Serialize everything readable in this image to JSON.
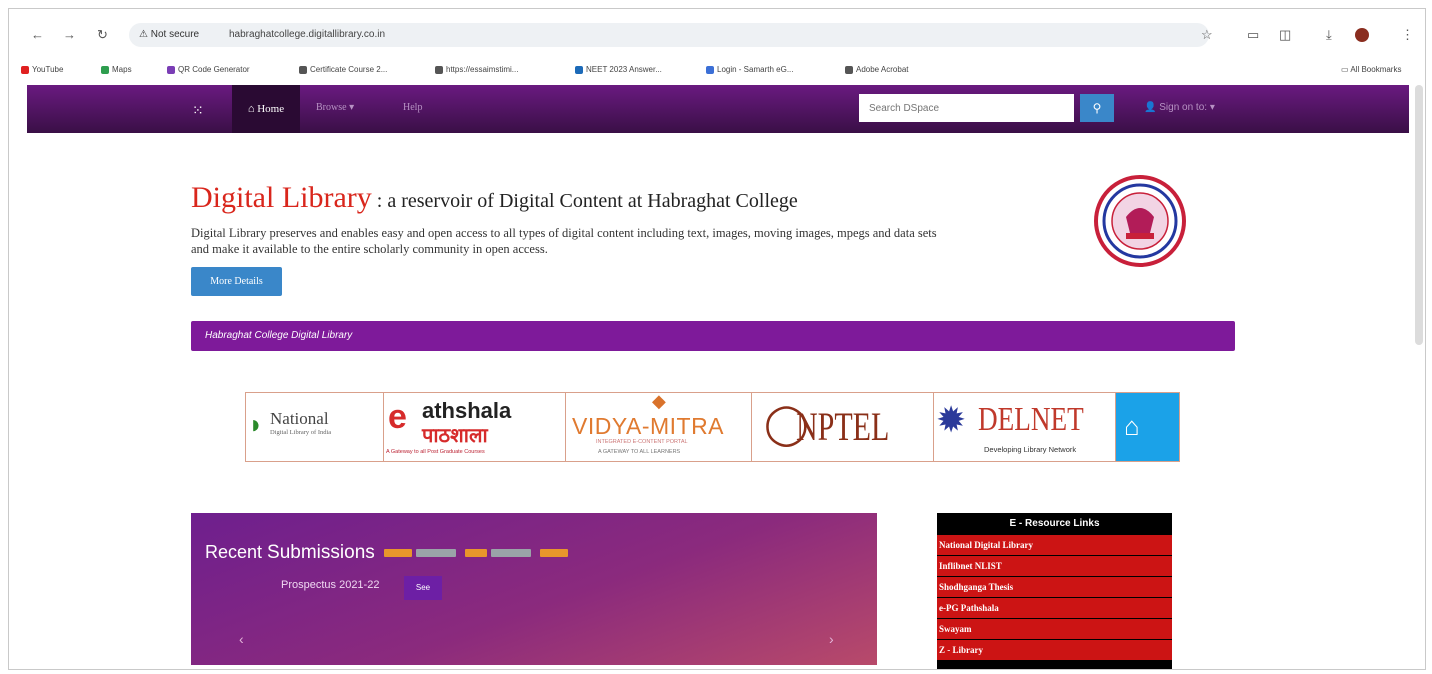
{
  "browser": {
    "security": "Not secure",
    "url": "habraghatcollege.digitallibrary.co.in",
    "bookmarks": [
      {
        "label": "YouTube",
        "color": "#e02020"
      },
      {
        "label": "Maps",
        "color": "#2e9e4f"
      },
      {
        "label": "QR Code Generator",
        "color": "#7a3db5"
      },
      {
        "label": "Certificate Course 2...",
        "color": "#555555"
      },
      {
        "label": "https://essaimstimi...",
        "color": "#555555"
      },
      {
        "label": "NEET 2023 Answer...",
        "color": "#1c6ab8"
      },
      {
        "label": "Login - Samarth eG...",
        "color": "#3b6fd6"
      },
      {
        "label": "Adobe Acrobat",
        "color": "#555555"
      }
    ],
    "all_bookmarks": "All Bookmarks"
  },
  "navbar": {
    "home": "Home",
    "browse": "Browse",
    "help": "Help",
    "search_placeholder": "Search DSpace",
    "signin": "Sign on to:"
  },
  "hero": {
    "title_big": "Digital Library",
    "title_rest": " : a reservoir of Digital Content at Habraghat College",
    "description": "Digital Library preserves and enables easy and open access to all types of digital content including text, images, moving images, mpegs and data sets and make it available to the entire scholarly community in open access.",
    "more_button": "More Details"
  },
  "banner": {
    "text": "Habraghat College Digital Library"
  },
  "logos": {
    "ndl": "National",
    "ndl_sub": "Digital Library of India",
    "pathshala": "athshala",
    "pathshala_hi": "पाठशाला",
    "pathshala_sub": "A Gateway to all Post Graduate Courses",
    "vidya": "VIDYA-MITRA",
    "vidya_sub1": "INTEGRATED E-CONTENT PORTAL",
    "vidya_sub2": "A GATEWAY TO ALL LEARNERS",
    "nptel": "NPTEL",
    "delnet": "DELNET",
    "delnet_sub": "Developing Library Network"
  },
  "recent": {
    "title_part1": "Recent ",
    "title_part2": "Submissions",
    "item": "Prospectus 2021-22",
    "see_button": "See"
  },
  "eresources": {
    "heading": "E - Resource Links",
    "items": [
      "National Digital Library",
      "Inflibnet NLIST",
      "Shodhganga Thesis",
      "e-PG Pathshala",
      "Swayam",
      "Z - Library"
    ]
  }
}
